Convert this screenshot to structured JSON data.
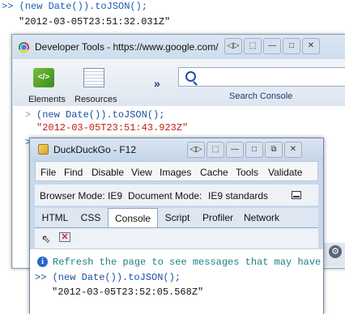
{
  "background_console": {
    "command": ">> (new Date()).toJSON();",
    "result": "\"2012-03-05T23:51:32.031Z\""
  },
  "chrome_devtools": {
    "title": "Developer Tools - https://www.google.com/",
    "toolbar": {
      "elements_label": "Elements",
      "resources_label": "Resources",
      "more_label": "»",
      "search_label": "Search Console"
    },
    "console": {
      "prompt": ">",
      "command": "(new Date()).toJSON();",
      "result": "\"2012-03-05T23:51:43.923Z\"",
      "input_prompt": ">"
    }
  },
  "ie_devtools": {
    "title": "DuckDuckGo - F12",
    "menu": [
      "File",
      "Find",
      "Disable",
      "View",
      "Images",
      "Cache",
      "Tools",
      "Validate"
    ],
    "browser_mode_label": "Browser Mode:",
    "browser_mode_value": "IE9",
    "document_mode_label": "Document Mode:",
    "document_mode_value": "IE9 standards",
    "tabs": [
      "HTML",
      "CSS",
      "Console",
      "Script",
      "Profiler",
      "Network"
    ],
    "active_tab": "Console",
    "console": {
      "info_message": "Refresh the page to see messages that may have",
      "command": ">> (new Date()).toJSON();",
      "result": "\"2012-03-05T23:52:05.568Z\""
    }
  },
  "colors": {
    "command_blue": "#1c4fa3",
    "result_red": "#c41a16",
    "info_teal": "#1b7f82",
    "window_frame": "#c9d8ea"
  },
  "icons": [
    "chrome-logo-icon",
    "elements-icon",
    "resources-icon",
    "search-icon",
    "gear-icon",
    "ie-icon",
    "select-cursor-icon",
    "clear-console-icon",
    "info-icon",
    "minimize-panel-icon"
  ]
}
